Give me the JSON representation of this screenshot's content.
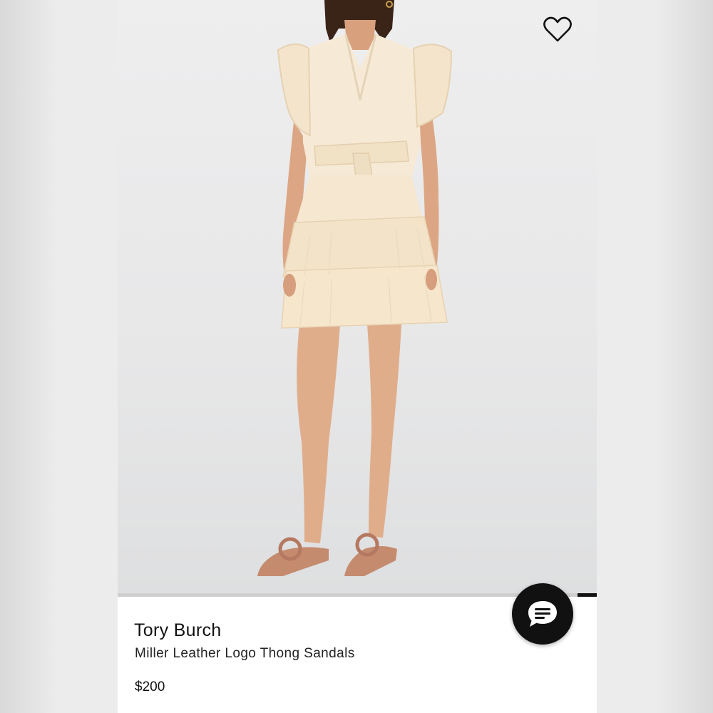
{
  "listing": {
    "brand": "Tory Burch",
    "product_name": "Miller Leather Logo Thong Sandals",
    "price": "$200"
  },
  "icons": {
    "favorite": "heart-outline-icon",
    "chat": "chat-bubble-icon"
  },
  "gallery": {
    "progress_fraction": 0.04
  },
  "colors": {
    "dress": "#f4e8d2",
    "sandal": "#c58d72",
    "skin": "#e3b08e",
    "chat_button": "#111111"
  }
}
